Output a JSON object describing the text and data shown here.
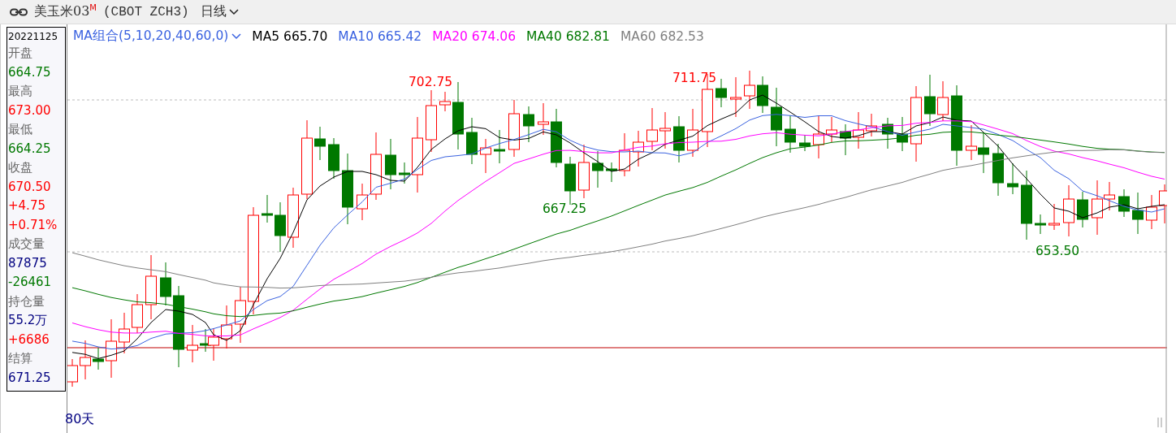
{
  "header": {
    "symbol": "美玉米03",
    "badge": "M",
    "code": "(CBOT ZCH3)",
    "period": "日线"
  },
  "info": {
    "date": "20221125",
    "items": [
      {
        "kind": "label",
        "text": "开盘"
      },
      {
        "kind": "down",
        "text": "664.75"
      },
      {
        "kind": "label",
        "text": "最高"
      },
      {
        "kind": "up",
        "text": "673.00"
      },
      {
        "kind": "label",
        "text": "最低"
      },
      {
        "kind": "down",
        "text": "664.25"
      },
      {
        "kind": "label",
        "text": "收盘"
      },
      {
        "kind": "up",
        "text": "670.50"
      },
      {
        "kind": "up",
        "text": "+4.75"
      },
      {
        "kind": "up",
        "text": "+0.71%"
      },
      {
        "kind": "label",
        "text": "成交量"
      },
      {
        "kind": "neutral",
        "text": "87875"
      },
      {
        "kind": "down",
        "text": "-26461"
      },
      {
        "kind": "label",
        "text": "持仓量"
      },
      {
        "kind": "neutral",
        "text": "55.2万"
      },
      {
        "kind": "up",
        "text": "+6686"
      },
      {
        "kind": "label",
        "text": "结算"
      },
      {
        "kind": "neutral",
        "text": "671.25"
      }
    ]
  },
  "legend": {
    "title": "MA组合(5,10,20,40,60,0)",
    "items": [
      {
        "name": "MA5",
        "value": "665.70",
        "color": "#000000"
      },
      {
        "name": "MA10",
        "value": "665.42",
        "color": "#3a62e0"
      },
      {
        "name": "MA20",
        "value": "674.06",
        "color": "#ff00ff"
      },
      {
        "name": "MA40",
        "value": "682.81",
        "color": "#007800"
      },
      {
        "name": "MA60",
        "value": "682.53",
        "color": "#808080"
      }
    ]
  },
  "price_labels": [
    {
      "text": "702.75",
      "kind": "high"
    },
    {
      "text": "711.75",
      "kind": "high"
    },
    {
      "text": "667.25",
      "kind": "low"
    },
    {
      "text": "653.50",
      "kind": "low"
    }
  ],
  "range": "80天"
}
